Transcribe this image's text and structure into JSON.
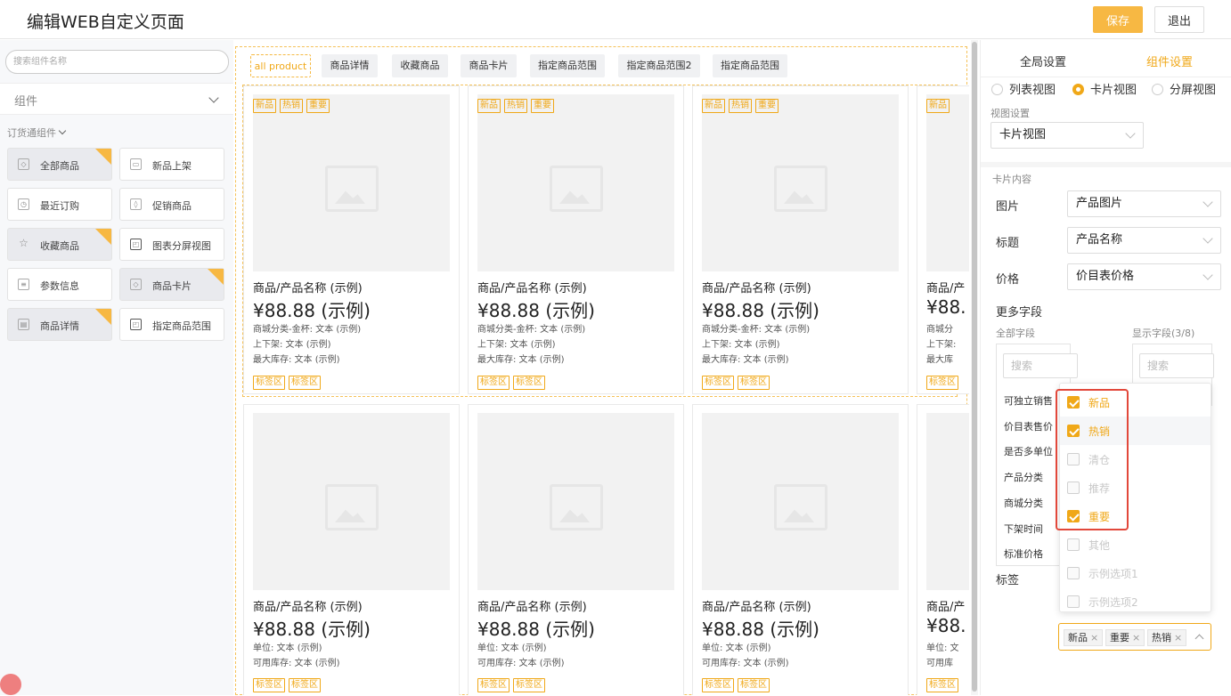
{
  "header": {
    "title": "编辑WEB自定义页面",
    "save_label": "保存",
    "exit_label": "退出"
  },
  "left": {
    "search_placeholder": "搜索组件名称",
    "section_title": "组件",
    "group_label": "订货通组件",
    "components": [
      {
        "label": "全部商品",
        "icon": "cube-icon",
        "selected": true
      },
      {
        "label": "新品上架",
        "icon": "image-icon",
        "selected": false
      },
      {
        "label": "最近订购",
        "icon": "clock-icon",
        "selected": false
      },
      {
        "label": "促销商品",
        "icon": "tag-icon",
        "selected": false
      },
      {
        "label": "收藏商品",
        "icon": "star-icon",
        "selected": true
      },
      {
        "label": "图表分屏视图",
        "icon": "split-view-icon",
        "selected": false
      },
      {
        "label": "参数信息",
        "icon": "document-icon",
        "selected": false
      },
      {
        "label": "商品卡片",
        "icon": "cube-icon",
        "selected": true
      },
      {
        "label": "商品详情",
        "icon": "detail-icon",
        "selected": true
      },
      {
        "label": "指定商品范围",
        "icon": "split-view-icon",
        "selected": false
      }
    ]
  },
  "canvas": {
    "tabs": [
      "all product",
      "商品详情",
      "收藏商品",
      "商品卡片",
      "指定商品范围",
      "指定商品范围2",
      "指定商品范围"
    ],
    "card_tags": [
      "新品",
      "热销",
      "重要"
    ],
    "card_name": "商品/产品名称 (示例)",
    "card_price": "¥88.88 (示例)",
    "row1_fields": [
      "商城分类-金杯: 文本 (示例)",
      "上下架: 文本 (示例)",
      "最大库存: 文本 (示例)"
    ],
    "row2_fields": [
      "单位: 文本 (示例)",
      "可用库存: 文本 (示例)"
    ],
    "bottom_tags": [
      "标签区",
      "标签区"
    ],
    "cut_card": {
      "tag": "新品",
      "name": "商品/产",
      "price": "¥88.",
      "fields1": [
        "商城分",
        "上下架:",
        "最大库"
      ],
      "fields2": [
        "单位: 文",
        "可用库"
      ],
      "btag": "标签区"
    }
  },
  "right": {
    "tabs": [
      "全局设置",
      "组件设置"
    ],
    "views": [
      "列表视图",
      "卡片视图",
      "分屏视图"
    ],
    "view_setting_label": "视图设置",
    "view_select": "卡片视图",
    "card_content_label": "卡片内容",
    "rows": [
      {
        "label": "图片",
        "value": "产品图片"
      },
      {
        "label": "标题",
        "value": "产品名称"
      },
      {
        "label": "价格",
        "value": "价目表价格"
      }
    ],
    "more_fields_label": "更多字段",
    "all_fields_label": "全部字段",
    "shown_fields_label": "显示字段(3/8)",
    "search_placeholder": "搜索",
    "fields": [
      "可独立销售",
      "价目表售价",
      "是否多单位",
      "产品分类",
      "商城分类",
      "下架时间",
      "标准价格"
    ],
    "tag_label": "标签",
    "tag_options": [
      {
        "label": "新品",
        "checked": true
      },
      {
        "label": "热销",
        "checked": true
      },
      {
        "label": "清仓",
        "checked": false
      },
      {
        "label": "推荐",
        "checked": false
      },
      {
        "label": "重要",
        "checked": true
      },
      {
        "label": "其他",
        "checked": false
      },
      {
        "label": "示例选项1",
        "checked": false
      },
      {
        "label": "示例选项2",
        "checked": false
      }
    ],
    "selected_tags": [
      "新品",
      "重要",
      "热销"
    ],
    "accent": "#f0a818"
  }
}
